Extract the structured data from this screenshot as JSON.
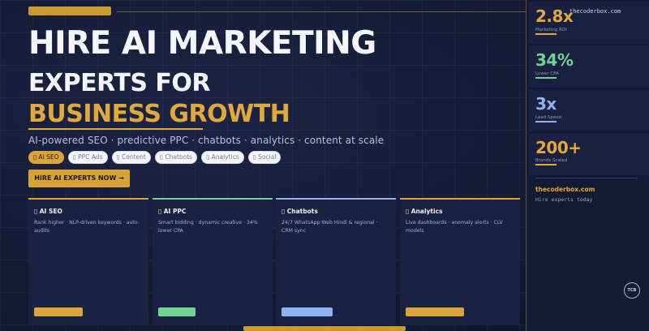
{
  "hero": {
    "line1": "HIRE AI MARKETING",
    "line2": "EXPERTS FOR",
    "line3": "BUSINESS GROWTH",
    "subtitle": "AI-powered SEO · predictive PPC · chatbots · analytics · content at scale",
    "cta": "HIRE AI EXPERTS NOW →"
  },
  "chips": [
    {
      "label": "▯ AI SEO"
    },
    {
      "label": "▯ PPC Ads"
    },
    {
      "label": "▯ Content"
    },
    {
      "label": "▯ Chatbots"
    },
    {
      "label": "▯ Analytics"
    },
    {
      "label": "▯ Social"
    }
  ],
  "cards": [
    {
      "title": "▯ AI SEO",
      "desc": "Rank higher · NLP-driven keywords · auto-audits",
      "accent": "#d9a43a"
    },
    {
      "title": "▯ AI PPC",
      "desc": "Smart bidding · dynamic creative · 34% lower CPA",
      "accent": "#6fd391"
    },
    {
      "title": "▯ Chatbots",
      "desc": "24/7 WhatsApp·Web Hindi & regional · CRM sync",
      "accent": "#8cb4f2"
    },
    {
      "title": "▯ Analytics",
      "desc": "Live dashboards · anomaly alerts · CLV models",
      "accent": "#d9a43a"
    }
  ],
  "sidebar": {
    "site_small": "thecoderbox.com",
    "stats": [
      {
        "value": "2.8x",
        "label": "Marketing ROI",
        "color": "#e0a93a"
      },
      {
        "value": "34%",
        "label": "Lower CPA",
        "color": "#6fd391"
      },
      {
        "value": "3x",
        "label": "Lead Speed",
        "color": "#8cb4f2"
      },
      {
        "value": "200+",
        "label": "Brands Scaled",
        "color": "#e0a93a"
      }
    ],
    "site": "thecoderbox.com",
    "tagline": "Hire experts today",
    "badge": "TCB"
  }
}
